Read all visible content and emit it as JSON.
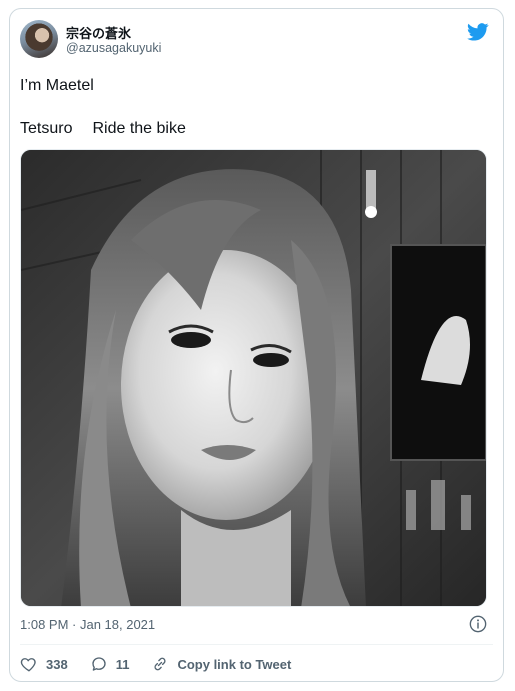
{
  "author": {
    "display_name": "宗谷の蒼氷",
    "handle": "@azusagakuyuki"
  },
  "tweet": {
    "line1": "I’m Maetel",
    "line2_a": "Tetsuro",
    "line2_b": "Ride the bike"
  },
  "meta": {
    "timestamp": "1:08 PM · Jan 18, 2021"
  },
  "actions": {
    "likes": "338",
    "replies": "11",
    "copy_label": "Copy link to Tweet"
  },
  "colors": {
    "twitter_blue": "#1d9bf0",
    "secondary_text": "#536471",
    "border": "#cfd9de"
  },
  "icons": {
    "logo": "twitter-bird-icon",
    "info": "info-icon",
    "like": "heart-icon",
    "reply": "reply-bubble-icon",
    "copy": "link-icon"
  }
}
